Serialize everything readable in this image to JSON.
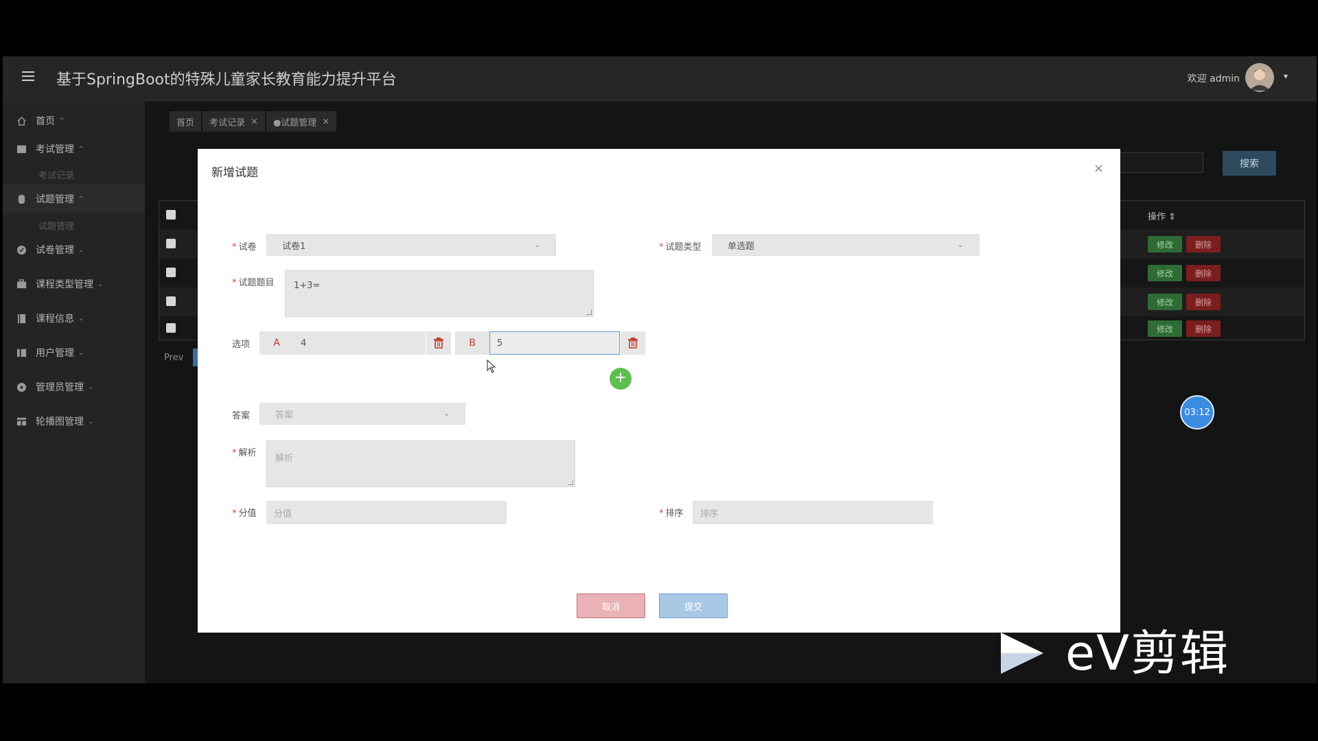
{
  "header": {
    "title": "基于SpringBoot的特殊儿童家长教育能力提升平台",
    "welcome": "欢迎 admin"
  },
  "sidebar": {
    "items": [
      {
        "label": "首页",
        "icon": "home-icon"
      },
      {
        "label": "考试管理",
        "icon": "exam-icon"
      },
      {
        "label": "试题管理",
        "icon": "question-icon"
      },
      {
        "label": "试卷管理",
        "icon": "paper-icon"
      },
      {
        "label": "课程类型管理",
        "icon": "briefcase-icon"
      },
      {
        "label": "课程信息",
        "icon": "book-icon"
      },
      {
        "label": "用户管理",
        "icon": "user-icon"
      },
      {
        "label": "管理员管理",
        "icon": "admin-icon"
      },
      {
        "label": "轮播图管理",
        "icon": "carousel-icon"
      }
    ],
    "subitems": {
      "exam_record": "考试记录",
      "question_manage": "试题管理"
    }
  },
  "tabs": [
    {
      "label": "首页"
    },
    {
      "label": "考试记录",
      "close": "×"
    },
    {
      "label": "●试题管理",
      "close": "×"
    }
  ],
  "toolbar": {
    "search_label": "搜索"
  },
  "table": {
    "op_header": "操作 ⇕",
    "edit_label": "修改",
    "delete_label": "删除"
  },
  "pagination": {
    "prev": "Prev"
  },
  "timer": "03:12",
  "watermark": "eV剪辑",
  "modal": {
    "title": "新增试题",
    "close": "×",
    "fields": {
      "paper_label": "试卷",
      "paper_value": "试卷1",
      "type_label": "试题类型",
      "type_value": "单选题",
      "question_label": "试题题目",
      "question_value": "1+3=",
      "options_label": "选项",
      "option_a_letter": "A",
      "option_a_value": "4",
      "option_b_letter": "B",
      "option_b_value": "5",
      "answer_label": "答案",
      "answer_placeholder": "答案",
      "analysis_label": "解析",
      "analysis_placeholder": "解析",
      "score_label": "分值",
      "score_placeholder": "分值",
      "order_label": "排序",
      "order_placeholder": "排序"
    },
    "required_mark": "*",
    "add_option": "+",
    "cancel_label": "取消",
    "submit_label": "提交"
  },
  "colors": {
    "danger": "#c0392b",
    "success": "#5cc04e",
    "primary": "#3b8be0"
  }
}
